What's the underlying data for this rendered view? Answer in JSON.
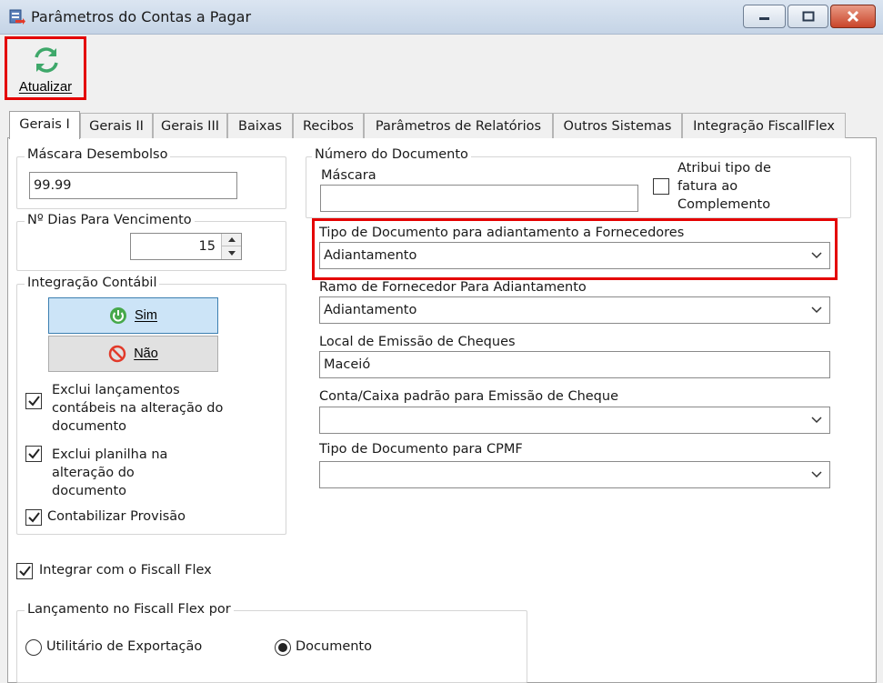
{
  "window": {
    "title": "Parâmetros do Contas a Pagar"
  },
  "toolbar": {
    "refresh_label": "Atualizar"
  },
  "tabs": [
    {
      "label": "Gerais I",
      "active": true
    },
    {
      "label": "Gerais II"
    },
    {
      "label": "Gerais III"
    },
    {
      "label": "Baixas"
    },
    {
      "label": "Recibos"
    },
    {
      "label": "Parâmetros de Relatórios"
    },
    {
      "label": "Outros Sistemas"
    },
    {
      "label": "Integração FiscallFlex"
    }
  ],
  "mascara_desembolso": {
    "label": "Máscara Desembolso",
    "value": "99.99"
  },
  "dias_vencimento": {
    "label": "Nº Dias Para Vencimento",
    "value": "15"
  },
  "integracao_contabil": {
    "label": "Integração Contábil",
    "sim_label": "Sim",
    "nao_label": "Não",
    "options": [
      {
        "label": "Exclui lançamentos contábeis na alteração do documento",
        "checked": true
      },
      {
        "label": "Exclui planilha na alteração do documento",
        "checked": true
      },
      {
        "label": "Contabilizar Provisão",
        "checked": true
      }
    ]
  },
  "numero_documento": {
    "label": "Número do Documento",
    "mascara_label": "Máscara",
    "mascara_value": "",
    "atribui_label": "Atribui tipo de fatura ao Complemento",
    "atribui_checked": false
  },
  "fields": {
    "tipo_doc_adiantamento": {
      "label": "Tipo de Documento para adiantamento a Fornecedores",
      "value": "Adiantamento"
    },
    "ramo_fornecedor": {
      "label": "Ramo de Fornecedor Para Adiantamento",
      "value": "Adiantamento"
    },
    "local_emissao": {
      "label": "Local de Emissão de Cheques",
      "value": "Maceió"
    },
    "conta_caixa": {
      "label": "Conta/Caixa padrão para Emissão de Cheque",
      "value": ""
    },
    "tipo_doc_cpmf": {
      "label": "Tipo de Documento para CPMF",
      "value": ""
    }
  },
  "fiscall": {
    "integrar_label": "Integrar com o Fiscall Flex",
    "integrar_checked": true,
    "lancamento_label": "Lançamento no Fiscall Flex por",
    "radios": [
      {
        "label": "Utilitário de Exportação",
        "selected": false
      },
      {
        "label": "Documento",
        "selected": true
      }
    ]
  },
  "colors": {
    "highlight": "#e40000",
    "sim_button": "#cce4f7",
    "refresh_icon": "#3ea86a"
  }
}
